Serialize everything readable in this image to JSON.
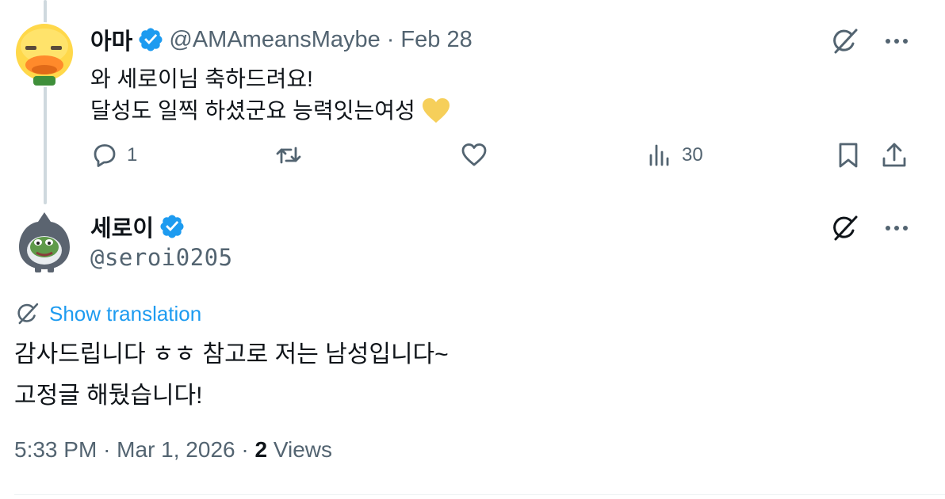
{
  "reply": {
    "avatar_icon": "duck-avatar-icon",
    "display_name": "아마",
    "handle": "@AMAmeansMaybe",
    "separator": "·",
    "date": "Feb 28",
    "text_line1": "와 세로이님 축하드려요!",
    "text_line2": "달성도 일찍 하셨군요 능력잇는여성",
    "emoji": "yellow-heart-icon",
    "actions": {
      "reply_count": "1",
      "retweet_count": "",
      "like_count": "",
      "views_count": "30"
    }
  },
  "main": {
    "avatar_icon": "pepe-shark-avatar-icon",
    "display_name": "세로이",
    "handle": "@seroi0205",
    "translate_label": "Show translation",
    "text_line1": "감사드립니다 ㅎㅎ 참고로 저는 남성입니다~",
    "text_line2": "고정글 해뒀습니다!",
    "time": "5:33 PM",
    "separator": "·",
    "date": "Mar 1, 2026",
    "views_count": "2",
    "views_label": "Views"
  },
  "colors": {
    "text_primary": "#0f1419",
    "text_secondary": "#536471",
    "link": "#1d9bf0",
    "verified": "#1d9bf0",
    "thread_line": "#cfd9de"
  }
}
